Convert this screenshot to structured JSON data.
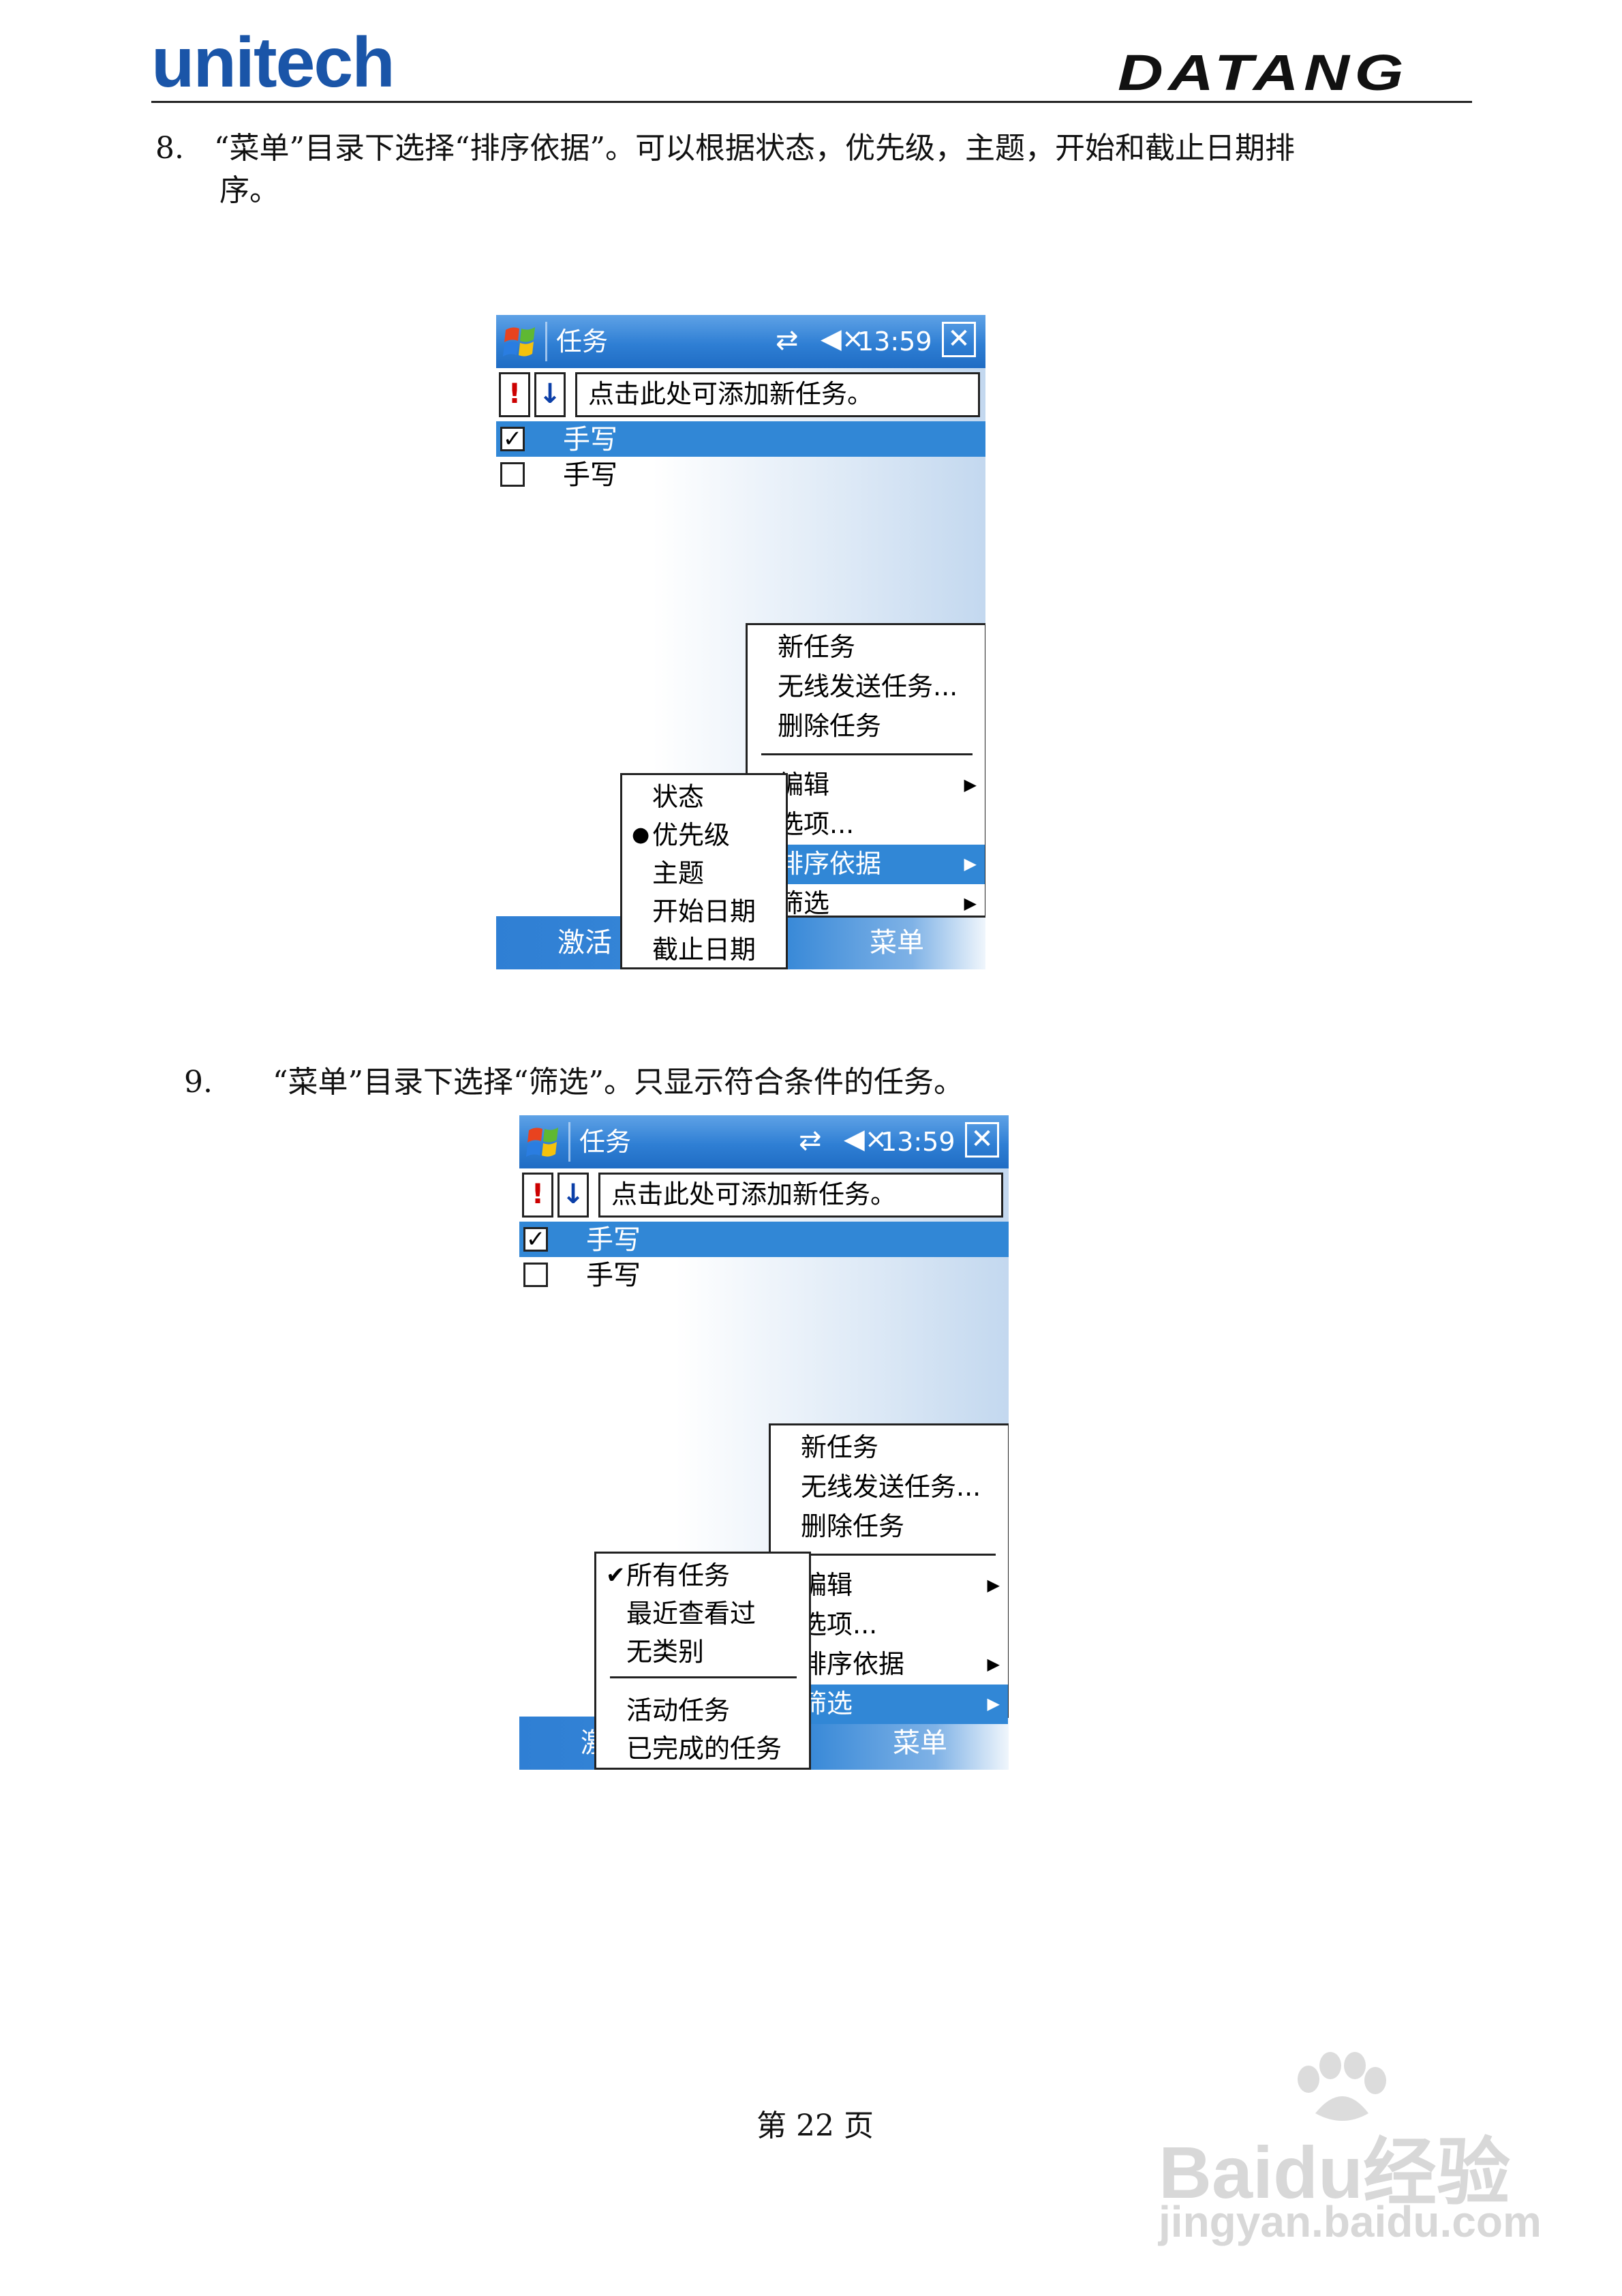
{
  "header": {
    "brand_left": "unitech",
    "brand_right": "DATANG"
  },
  "steps": [
    {
      "text_line1": "8.　“菜单”目录下选择“排序依据”。可以根据状态，优先级，主题，开始和截止日期排",
      "text_line2": "序。"
    },
    {
      "text_line1": "9.　　“菜单”目录下选择“筛选”。只显示符合条件的任务。"
    }
  ],
  "screens": [
    {
      "titlebar": {
        "title": "任务",
        "time": "13:59",
        "close": "✕"
      },
      "toolbar": {
        "priority": "!",
        "sort": "↓",
        "new_task_placeholder": "点击此处可添加新任务。"
      },
      "tasks": [
        {
          "label": "手写",
          "checked": true
        },
        {
          "label": "手写",
          "checked": false
        }
      ],
      "main_menu": {
        "items": [
          "新任务",
          "无线发送任务...",
          "删除任务",
          "编辑",
          "选项...",
          "排序依据",
          "筛选"
        ],
        "highlighted": "排序依据"
      },
      "submenu": {
        "items": [
          "状态",
          "优先级",
          "主题",
          "开始日期",
          "截止日期"
        ],
        "selected": "优先级"
      },
      "softkeys": {
        "left": "激活",
        "right": "菜单"
      }
    },
    {
      "titlebar": {
        "title": "任务",
        "time": "13:59",
        "close": "✕"
      },
      "toolbar": {
        "priority": "!",
        "sort": "↓",
        "new_task_placeholder": "点击此处可添加新任务。"
      },
      "tasks": [
        {
          "label": "手写",
          "checked": true
        },
        {
          "label": "手写",
          "checked": false
        }
      ],
      "main_menu": {
        "items": [
          "新任务",
          "无线发送任务...",
          "删除任务",
          "编辑",
          "选项...",
          "排序依据",
          "筛选"
        ],
        "highlighted": "筛选"
      },
      "submenu": {
        "items": [
          "所有任务",
          "最近查看过",
          "无类别",
          "活动任务",
          "已完成的任务"
        ],
        "selected": "所有任务"
      },
      "softkeys": {
        "left": "激",
        "right": "菜单"
      }
    }
  ],
  "footer": {
    "page": "第 22 页"
  },
  "watermark": {
    "brand": "Baidu经验",
    "url": "jingyan.baidu.com"
  },
  "colors": {
    "brand_blue": "#1a55a8",
    "titlebar_blue": "#2f7fd4",
    "highlight_blue": "#3187d6"
  }
}
